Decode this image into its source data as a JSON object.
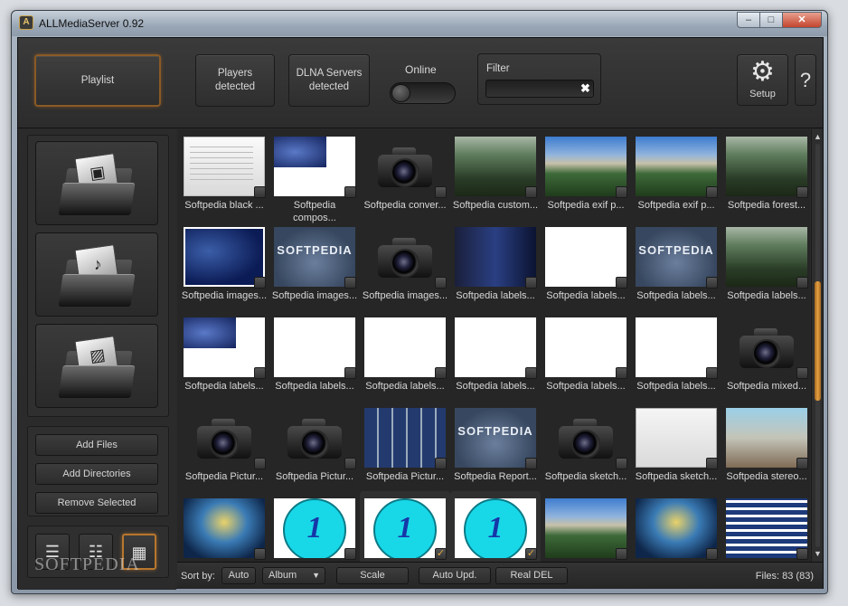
{
  "window": {
    "title": "ALLMediaServer 0.92",
    "logo_glyph": "A",
    "min_glyph": "–",
    "max_glyph": "□",
    "close_glyph": "✕"
  },
  "toolbar": {
    "playlist_label": "Playlist",
    "players_label_1": "Players",
    "players_label_2": "detected",
    "dlna_label_1": "DLNA Servers",
    "dlna_label_2": "detected",
    "online_label": "Online",
    "online_on": false,
    "filter_label": "Filter",
    "filter_value": "",
    "filter_clear_glyph": "✖",
    "setup_label": "Setup",
    "setup_glyph": "⚙",
    "help_label": "?"
  },
  "left": {
    "categories": [
      {
        "name": "video",
        "icon": "film-folder-icon",
        "glyph": "▣"
      },
      {
        "name": "music",
        "icon": "music-folder-icon",
        "glyph": "♪"
      },
      {
        "name": "photos",
        "icon": "photo-folder-icon",
        "glyph": "▨"
      }
    ],
    "add_files": "Add Files",
    "add_directories": "Add Directories",
    "remove_selected": "Remove Selected",
    "view_list_glyph": "☰",
    "view_details_glyph": "☷",
    "view_grid_glyph": "▦",
    "watermark": "SOFTPEDIA"
  },
  "grid": {
    "items": [
      {
        "label": "Softpedia black ...",
        "thumb": "doc",
        "checked": false
      },
      {
        "label": "Softpedia compos...",
        "thumb": "bluecorner",
        "checked": false
      },
      {
        "label": "Softpedia conver...",
        "thumb": "camera",
        "checked": false
      },
      {
        "label": "Softpedia custom...",
        "thumb": "forest",
        "checked": false
      },
      {
        "label": "Softpedia exif p...",
        "thumb": "mountain",
        "checked": false
      },
      {
        "label": "Softpedia exif p...",
        "thumb": "mountain",
        "checked": false
      },
      {
        "label": "Softpedia forest...",
        "thumb": "forest",
        "checked": false
      },
      {
        "label": "Softpedia images...",
        "thumb": "blueimg",
        "checked": false
      },
      {
        "label": "Softpedia images...",
        "thumb": "softpedia",
        "checked": false
      },
      {
        "label": "Softpedia images...",
        "thumb": "camera",
        "checked": false
      },
      {
        "label": "Softpedia labels...",
        "thumb": "darkblue",
        "checked": false
      },
      {
        "label": "Softpedia labels...",
        "thumb": "white",
        "checked": false
      },
      {
        "label": "Softpedia labels...",
        "thumb": "softpedia",
        "checked": false
      },
      {
        "label": "Softpedia labels...",
        "thumb": "forest",
        "checked": false
      },
      {
        "label": "Softpedia labels...",
        "thumb": "bluecorner",
        "checked": false
      },
      {
        "label": "Softpedia labels...",
        "thumb": "white",
        "checked": false
      },
      {
        "label": "Softpedia labels...",
        "thumb": "white",
        "checked": false
      },
      {
        "label": "Softpedia labels...",
        "thumb": "white",
        "checked": false
      },
      {
        "label": "Softpedia labels...",
        "thumb": "white",
        "checked": false
      },
      {
        "label": "Softpedia labels...",
        "thumb": "white",
        "checked": false
      },
      {
        "label": "Softpedia mixed...",
        "thumb": "camera",
        "checked": false
      },
      {
        "label": "Softpedia Pictur...",
        "thumb": "camera",
        "checked": false
      },
      {
        "label": "Softpedia Pictur...",
        "thumb": "camera",
        "checked": false
      },
      {
        "label": "Softpedia Pictur...",
        "thumb": "collage",
        "checked": false
      },
      {
        "label": "Softpedia Report...",
        "thumb": "softpedia",
        "checked": false
      },
      {
        "label": "Softpedia sketch...",
        "thumb": "camera",
        "checked": false
      },
      {
        "label": "Softpedia sketch...",
        "thumb": "sketch",
        "checked": false
      },
      {
        "label": "Softpedia stereo...",
        "thumb": "sphinx",
        "checked": false
      },
      {
        "label": "",
        "thumb": "swirl",
        "checked": false
      },
      {
        "label": "",
        "thumb": "clock",
        "checked": false
      },
      {
        "label": "",
        "thumb": "clock",
        "checked": true
      },
      {
        "label": "",
        "thumb": "clock",
        "checked": true
      },
      {
        "label": "",
        "thumb": "mountain",
        "checked": false
      },
      {
        "label": "",
        "thumb": "swirl",
        "checked": false
      },
      {
        "label": "",
        "thumb": "mosaic",
        "checked": false
      }
    ],
    "softpedia_text": "SOFTPEDIA",
    "clock_digit": "1",
    "check_glyph": "✓"
  },
  "scrollbar": {
    "up_glyph": "▲",
    "down_glyph": "▼"
  },
  "bottombar": {
    "sort_label": "Sort by:",
    "auto_label": "Auto",
    "album_value": "Album",
    "chevron_glyph": "▼",
    "scale_label": "Scale",
    "auto_upd_label": "Auto Upd.",
    "real_del_label": "Real DEL",
    "files_label": "Files:  83 (83)"
  },
  "colors": {
    "accent": "#e7a144",
    "background": "#2a2a2a",
    "clock": "#18d8e8"
  }
}
